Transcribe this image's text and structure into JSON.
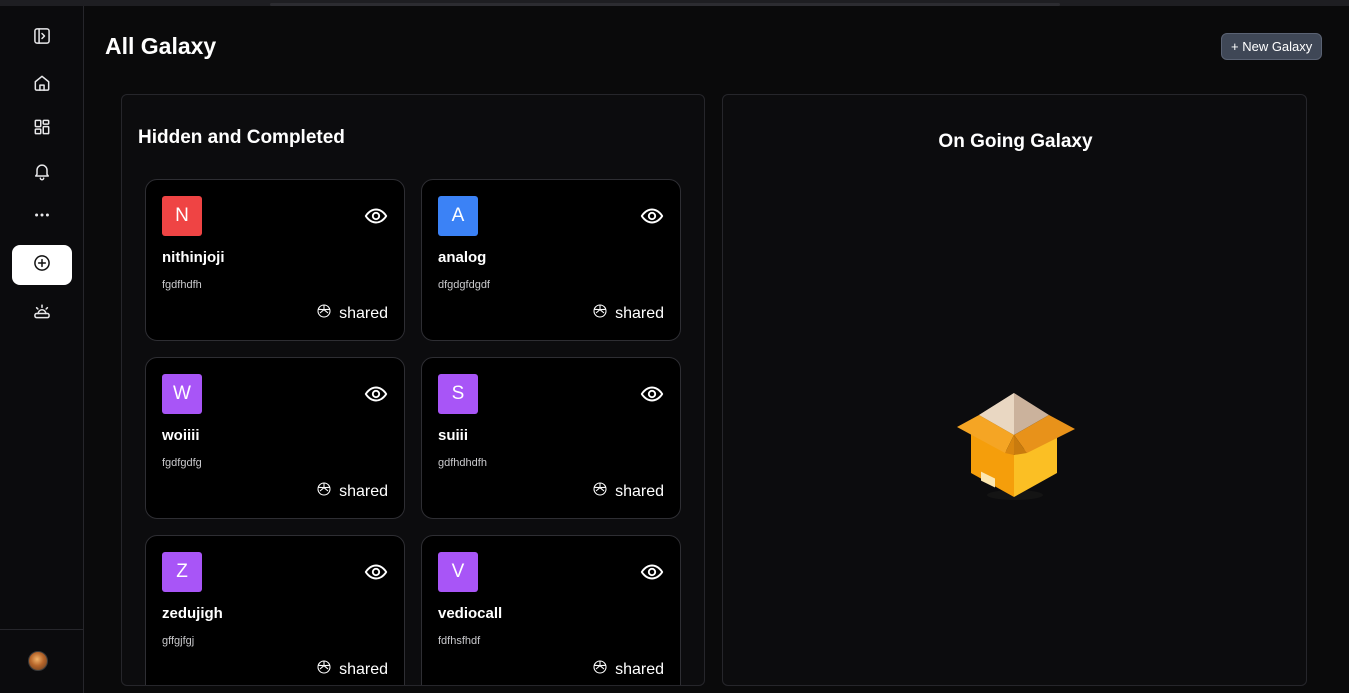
{
  "sidebar": {
    "items": [
      {
        "name": "sidebar-toggle",
        "icon": "panel-toggle-icon"
      },
      {
        "name": "home",
        "icon": "home-icon"
      },
      {
        "name": "dashboard",
        "icon": "grid-icon"
      },
      {
        "name": "notifications",
        "icon": "bell-icon"
      },
      {
        "name": "more",
        "icon": "more-horizontal-icon"
      },
      {
        "name": "create",
        "icon": "plus-circle-icon",
        "active": true
      },
      {
        "name": "sunrise",
        "icon": "sunrise-icon"
      }
    ],
    "avatar": "user-avatar"
  },
  "header": {
    "title": "All Galaxy",
    "new_button": "+ New Galaxy"
  },
  "hidden_panel": {
    "title": "Hidden and Completed",
    "cards": [
      {
        "initial": "N",
        "name": "nithinjoji",
        "desc": "fgdfhdfh",
        "shared": "shared",
        "color": "#ef4444"
      },
      {
        "initial": "A",
        "name": "analog",
        "desc": "dfgdgfdgdf",
        "shared": "shared",
        "color": "#3b82f6"
      },
      {
        "initial": "W",
        "name": "woiiii",
        "desc": "fgdfgdfg",
        "shared": "shared",
        "color": "#a855f7"
      },
      {
        "initial": "S",
        "name": "suiii",
        "desc": "gdfhdhdfh",
        "shared": "shared",
        "color": "#a855f7"
      },
      {
        "initial": "Z",
        "name": "zedujigh",
        "desc": "gffgjfgj",
        "shared": "shared",
        "color": "#a855f7"
      },
      {
        "initial": "V",
        "name": "vediocall",
        "desc": "fdfhsfhdf",
        "shared": "shared",
        "color": "#a855f7"
      }
    ]
  },
  "ongoing_panel": {
    "title": "On Going Galaxy",
    "empty_illustration": "open-box-icon"
  },
  "colors": {
    "background": "#0a0a0b",
    "new_button": "#3f4756"
  }
}
